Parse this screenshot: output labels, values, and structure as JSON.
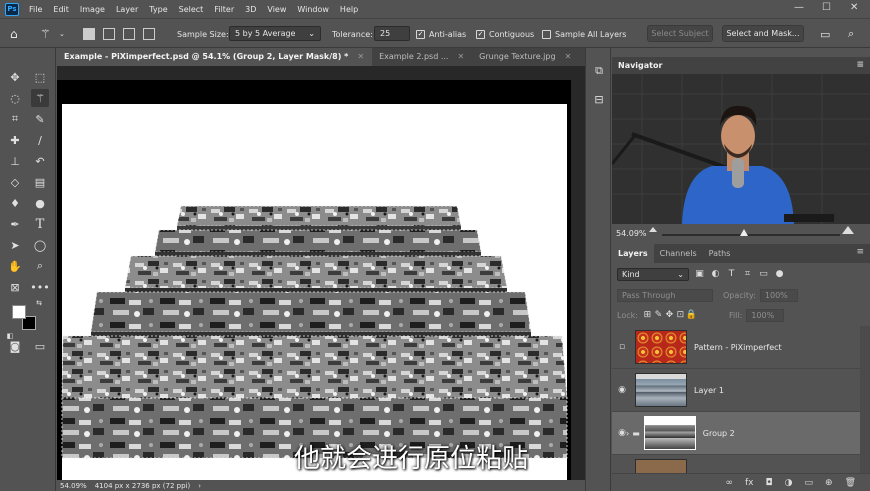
{
  "app": {
    "logo": "Ps"
  },
  "menu": [
    "File",
    "Edit",
    "Image",
    "Layer",
    "Type",
    "Select",
    "Filter",
    "3D",
    "View",
    "Window",
    "Help"
  ],
  "window_controls": {
    "minimize": "—",
    "maximize": "☐",
    "close": "✕"
  },
  "options": {
    "sample_size_label": "Sample Size:",
    "sample_size_value": "5 by 5 Average",
    "tolerance_label": "Tolerance:",
    "tolerance_value": "25",
    "anti_alias": "Anti-alias",
    "contiguous": "Contiguous",
    "sample_all_layers": "Sample All Layers",
    "select_subject": "Select Subject",
    "select_and_mask": "Select and Mask...",
    "check": "✓"
  },
  "tabs": [
    {
      "label": "Example - PiXimperfect.psd @ 54.1% (Group 2, Layer Mask/8) *",
      "close": "✕"
    },
    {
      "label": "Example 2.psd ...",
      "close": "✕"
    },
    {
      "label": "Grunge Texture.jpg",
      "close": "✕"
    }
  ],
  "subtitle": "他就会进行原位粘贴",
  "status": {
    "zoom": "54.09%",
    "doc_info": "4104 px x 2736 px (72 ppi)",
    "arrow": "›"
  },
  "navigator": {
    "title": "Navigator",
    "zoom": "54.09%",
    "menu": "≡"
  },
  "layers": {
    "tabs": [
      "Layers",
      "Channels",
      "Paths"
    ],
    "menu": "≡",
    "kind": "Kind",
    "kind_arrow": "⌄",
    "filter_icons": [
      "▣",
      "◐",
      "T",
      "⌗",
      "▭",
      "●"
    ],
    "blend_mode": "Pass Through",
    "opacity_label": "Opacity:",
    "opacity_value": "100%",
    "lock_label": "Lock:",
    "lock_icons": [
      "⊞",
      "✎",
      "✥",
      "⊡",
      "🔒"
    ],
    "fill_label": "Fill:",
    "fill_value": "100%",
    "eye": "◉",
    "group_arrow": "›",
    "folder": "▬",
    "items": [
      {
        "name": "Pattern - PiXimperfect"
      },
      {
        "name": "Layer 1"
      },
      {
        "name": "Group 2"
      }
    ],
    "bottom_icons": [
      "∞",
      "fx",
      "◘",
      "◑",
      "▭",
      "⊕",
      "🗑"
    ]
  },
  "colors": {
    "accent": "#31a8ff",
    "panel": "#535353",
    "dark": "#424242"
  }
}
